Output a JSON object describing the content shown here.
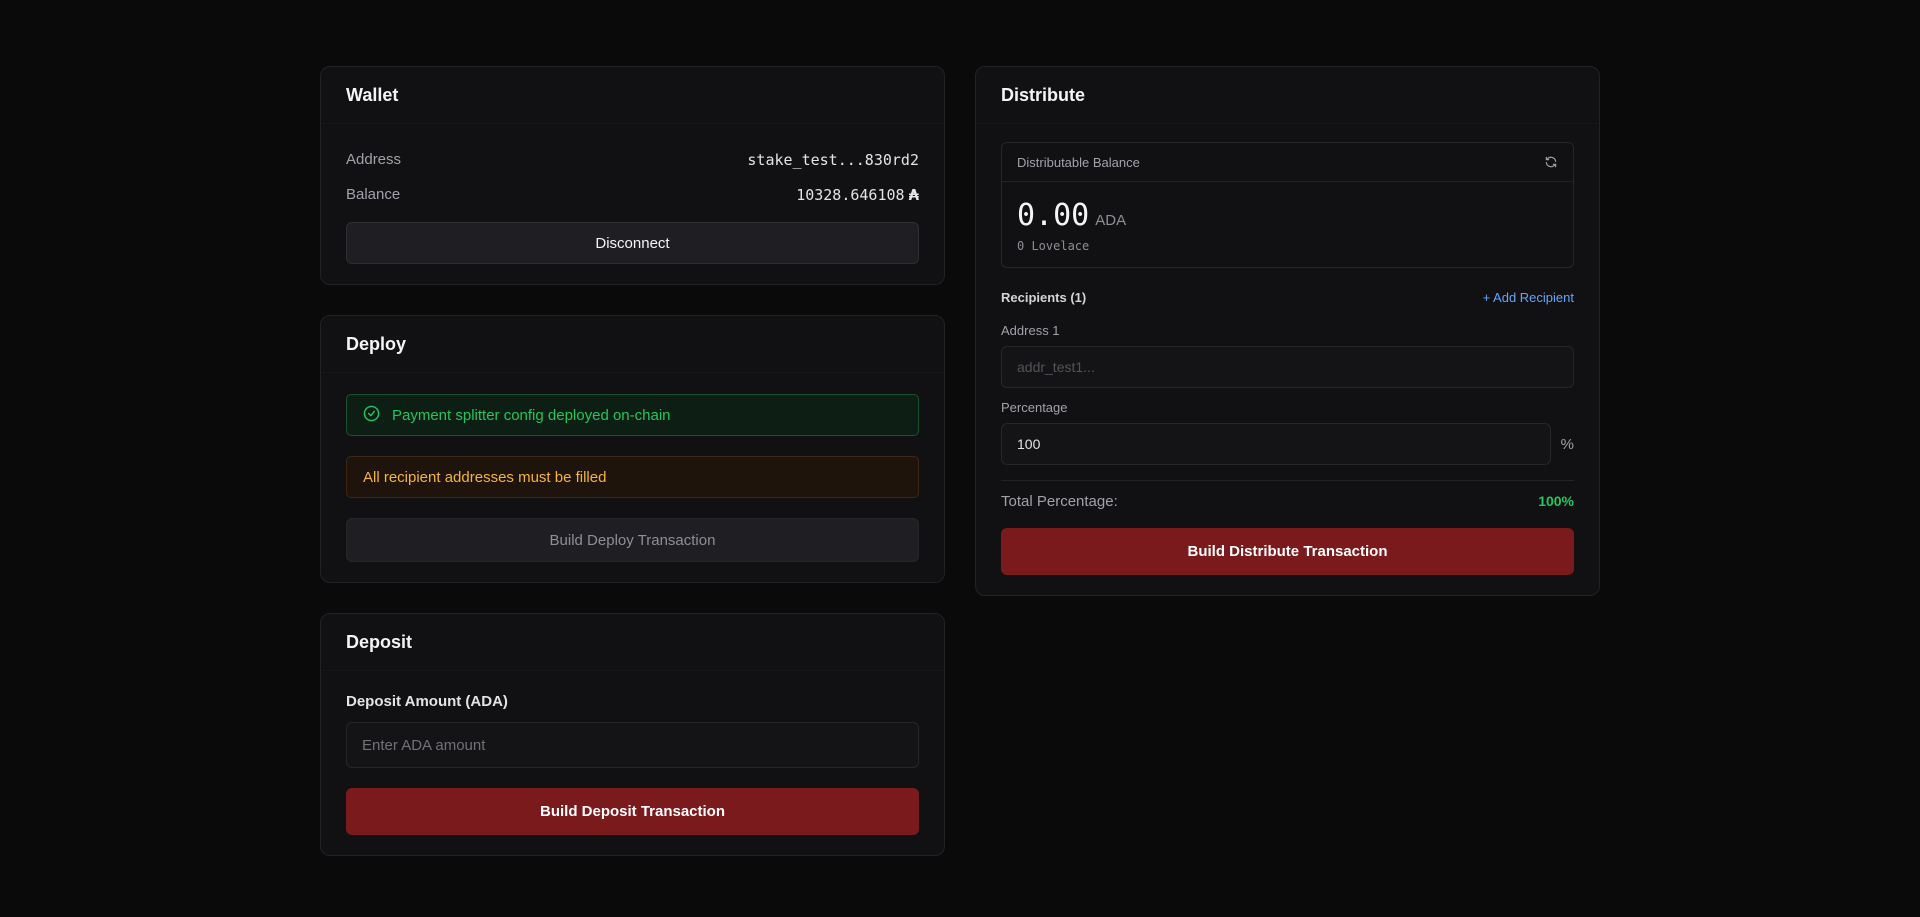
{
  "wallet": {
    "title": "Wallet",
    "address_label": "Address",
    "address_value": "stake_test...830rd2",
    "balance_label": "Balance",
    "balance_value": "10328.646108",
    "balance_unit_symbol": "₳",
    "disconnect_label": "Disconnect"
  },
  "deploy": {
    "title": "Deploy",
    "success_message": "Payment splitter config deployed on-chain",
    "warning_message": "All recipient addresses must be filled",
    "build_label": "Build Deploy Transaction"
  },
  "deposit": {
    "title": "Deposit",
    "amount_label": "Deposit Amount (ADA)",
    "amount_placeholder": "Enter ADA amount",
    "build_label": "Build Deposit Transaction"
  },
  "distribute": {
    "title": "Distribute",
    "balance_label": "Distributable Balance",
    "balance_value": "0.00",
    "balance_unit": "ADA",
    "lovelace_text": "0 Lovelace",
    "recipients_label": "Recipients (1)",
    "add_recipient_label": "+ Add Recipient",
    "address_label": "Address 1",
    "address_placeholder": "addr_test1...",
    "percentage_label": "Percentage",
    "percentage_value": "100",
    "percent_symbol": "%",
    "total_label": "Total Percentage:",
    "total_value": "100%",
    "build_label": "Build Distribute Transaction"
  },
  "colors": {
    "background": "#0a0a0b",
    "card": "#111113",
    "primary_button": "#7b1a1c",
    "success": "#22c55e",
    "warning": "#f5b43a",
    "link": "#60a5fa"
  }
}
